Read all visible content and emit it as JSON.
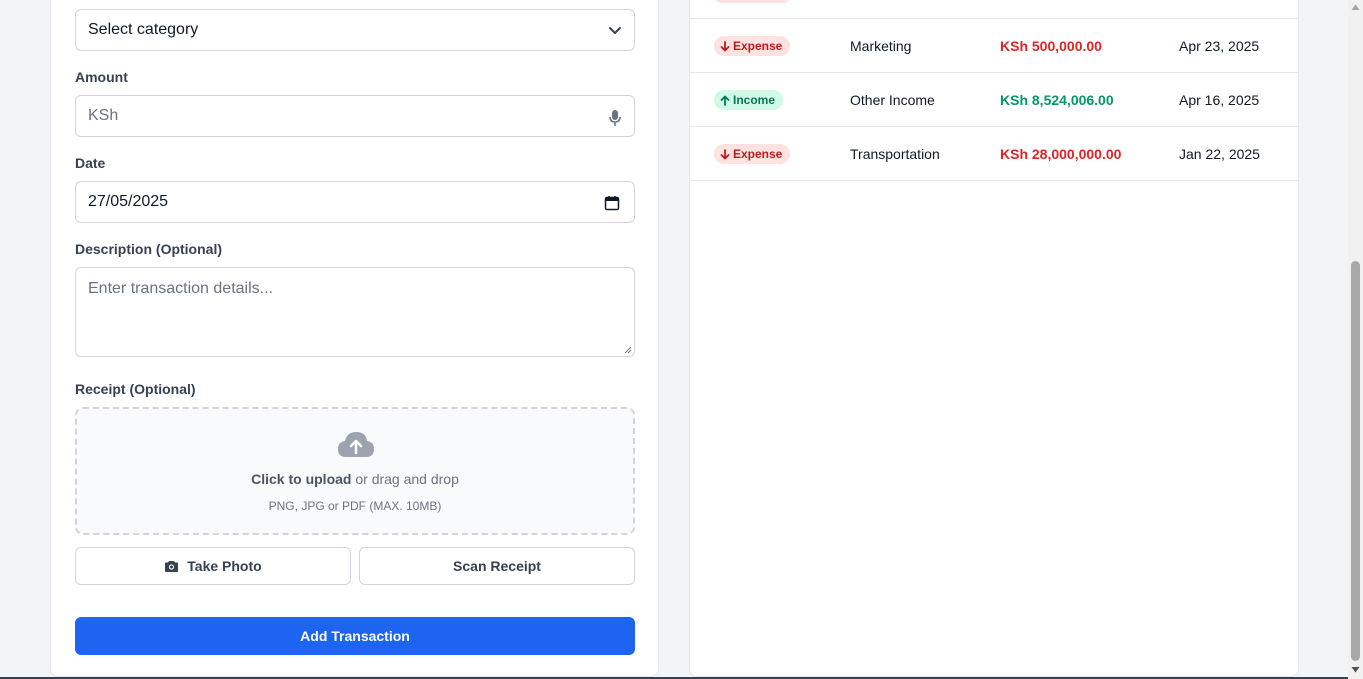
{
  "form": {
    "category_select": {
      "value": "Select category"
    },
    "amount": {
      "label": "Amount",
      "placeholder": "KSh"
    },
    "date": {
      "label": "Date",
      "value": "27/05/2025"
    },
    "description": {
      "label": "Description (Optional)",
      "placeholder": "Enter transaction details..."
    },
    "receipt": {
      "label": "Receipt (Optional)",
      "upload_strong": "Click to upload",
      "upload_rest": " or drag and drop",
      "hint": "PNG, JPG or PDF (MAX. 10MB)"
    },
    "take_photo_label": "Take Photo",
    "scan_receipt_label": "Scan Receipt",
    "submit_label": "Add Transaction"
  },
  "transactions": [
    {
      "type": "Expense",
      "category": "Marketing",
      "amount": "KSh 500,000.00",
      "date": "Apr 23, 2025"
    },
    {
      "type": "Income",
      "category": "Other Income",
      "amount": "KSh 8,524,006.00",
      "date": "Apr 16, 2025"
    },
    {
      "type": "Expense",
      "category": "Transportation",
      "amount": "KSh 28,000,000.00",
      "date": "Jan 22, 2025"
    }
  ],
  "colors": {
    "primary": "#1d64f0",
    "expense": "#dc2626",
    "income": "#059669"
  },
  "icons": [
    "chevron-down-icon",
    "microphone-icon",
    "calendar-icon",
    "cloud-upload-icon",
    "camera-icon",
    "arrow-down-icon",
    "arrow-up-icon"
  ]
}
